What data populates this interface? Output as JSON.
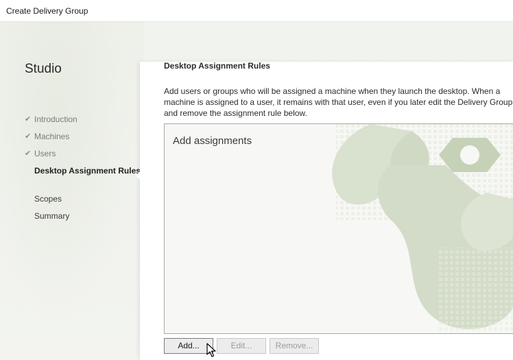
{
  "window": {
    "title": "Create Delivery Group"
  },
  "sidebar": {
    "app_title": "Studio",
    "items": [
      {
        "label": "Introduction",
        "state": "completed"
      },
      {
        "label": "Machines",
        "state": "completed"
      },
      {
        "label": "Users",
        "state": "completed"
      },
      {
        "label": "Desktop Assignment Rules",
        "state": "active"
      },
      {
        "label": "Scopes",
        "state": "pending"
      },
      {
        "label": "Summary",
        "state": "pending"
      }
    ]
  },
  "main": {
    "section_title": "Desktop Assignment Rules",
    "description": "Add users or groups who will be assigned a machine when they launch the desktop. When a machine is assigned to a user, it remains with that user, even if you later edit the Delivery Group and remove the assignment rule below.",
    "assignments_placeholder": "Add assignments",
    "buttons": {
      "add": "Add...",
      "edit": "Edit...",
      "remove": "Remove..."
    }
  },
  "icons": {
    "completed_step": "check-icon",
    "cursor": "mouse-pointer-icon"
  },
  "colors": {
    "watermark": "#cfd9c3",
    "active_text": "#1f1f1f",
    "completed_text": "#7a7a7a"
  }
}
